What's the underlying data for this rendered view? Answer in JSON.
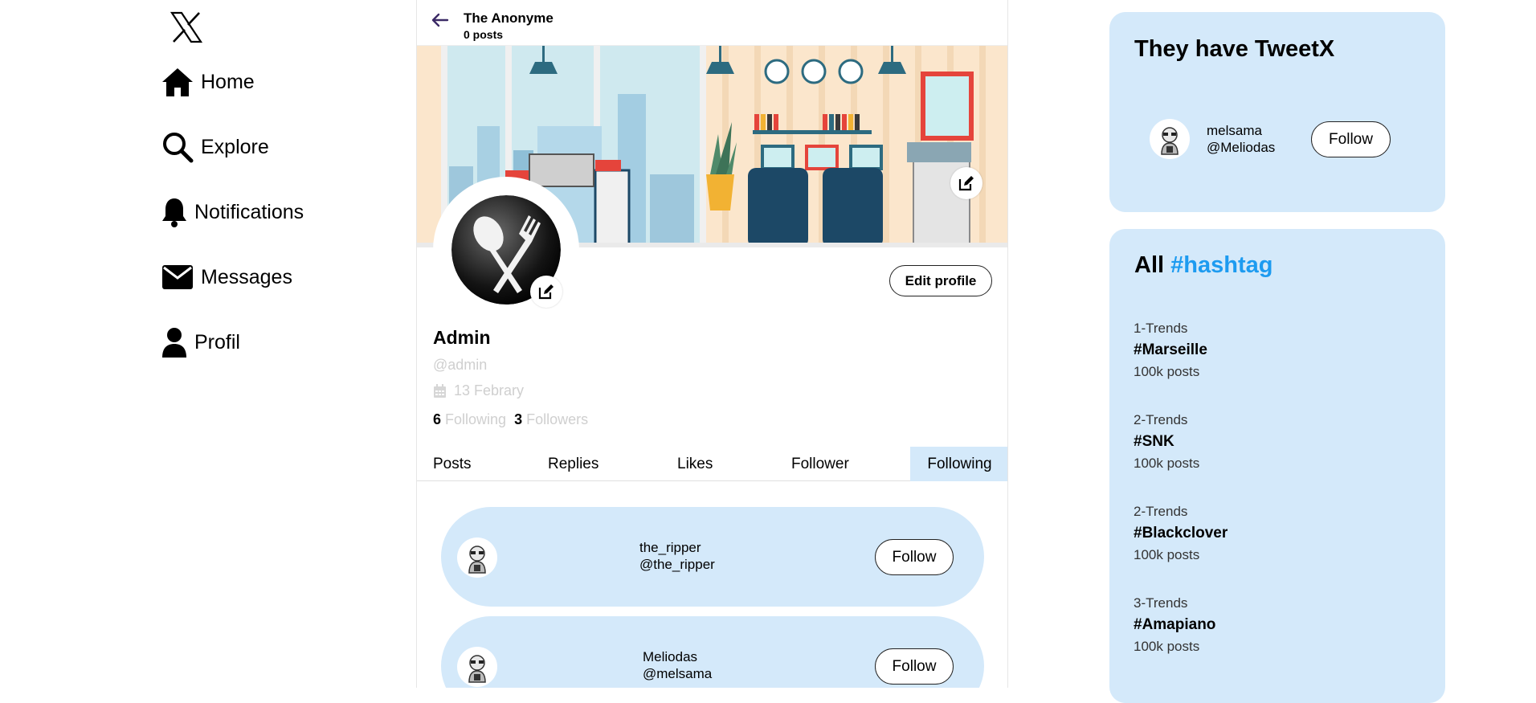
{
  "nav": {
    "items": [
      {
        "label": "Home"
      },
      {
        "label": "Explore"
      },
      {
        "label": "Notifications"
      },
      {
        "label": "Messages"
      },
      {
        "label": "Profil"
      }
    ]
  },
  "header": {
    "title": "The Anonyme",
    "posts": "0 posts"
  },
  "profile": {
    "name": "Admin",
    "handle": "@admin",
    "joined": "13 Febrary",
    "following_count": "6",
    "following_label": "Following",
    "followers_count": "3",
    "followers_label": "Followers",
    "edit_label": "Edit profile"
  },
  "tabs": [
    {
      "label": "Posts"
    },
    {
      "label": "Replies"
    },
    {
      "label": "Likes"
    },
    {
      "label": "Follower"
    },
    {
      "label": "Following"
    }
  ],
  "following_list": [
    {
      "name": "the_ripper",
      "handle": "@the_ripper",
      "button": "Follow"
    },
    {
      "name": "Meliodas",
      "handle": "@melsama",
      "button": "Follow"
    }
  ],
  "who": {
    "title": "They have TweetX",
    "user": {
      "name": "melsama",
      "handle": "@Meliodas",
      "button": "Follow"
    }
  },
  "trends": {
    "title_prefix": "All ",
    "title_accent": "#hashtag",
    "items": [
      {
        "category": "1-Trends",
        "tag": "#Marseille",
        "count": "100k posts"
      },
      {
        "category": "2-Trends",
        "tag": "#SNK",
        "count": "100k posts"
      },
      {
        "category": "2-Trends",
        "tag": "#Blackclover",
        "count": "100k posts"
      },
      {
        "category": "3-Trends",
        "tag": "#Amapiano",
        "count": "100k posts"
      }
    ]
  },
  "colors": {
    "panel": "#d4e9fa",
    "accent": "#1d9bf0"
  }
}
